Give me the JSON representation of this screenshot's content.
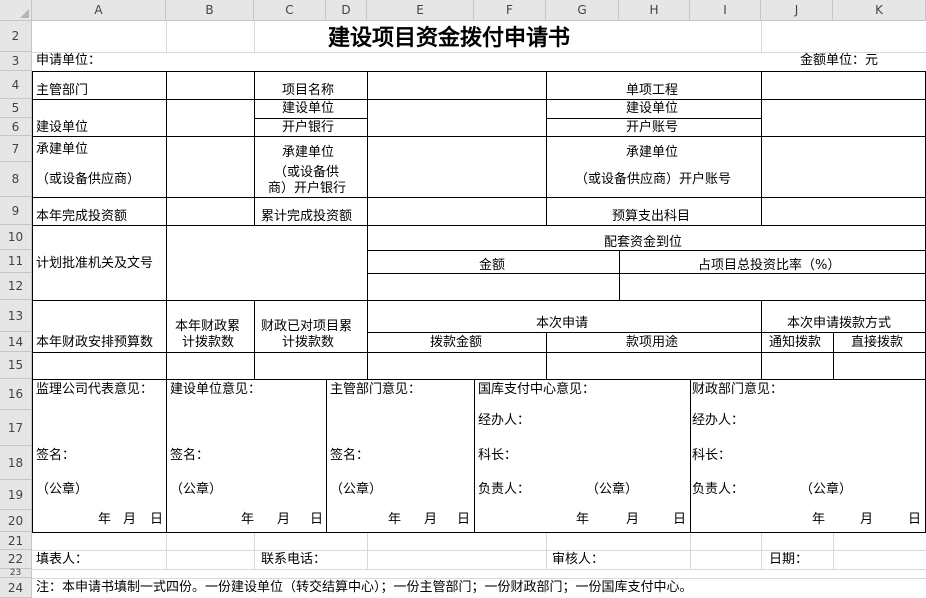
{
  "columns": [
    "A",
    "B",
    "C",
    "D",
    "E",
    "F",
    "G",
    "H",
    "I",
    "J",
    "K"
  ],
  "rows": [
    "2",
    "3",
    "4",
    "5",
    "6",
    "7",
    "8",
    "9",
    "10",
    "11",
    "12",
    "13",
    "14",
    "15",
    "16",
    "17",
    "18",
    "19",
    "20",
    "21",
    "22",
    "23",
    "24",
    "25"
  ],
  "form": {
    "title": "建设项目资金拨付申请书",
    "applicant_label": "申请单位：",
    "amount_unit": "金额单位：元",
    "dept": "主管部门",
    "project_name": "项目名称",
    "single_project": "单项工程",
    "build_unit": "建设单位",
    "bank": "开户银行",
    "account": "开户账号",
    "contractor_a": "承建单位",
    "supplier_paren": "（或设备供应商）",
    "contractor_bank_1": "（或设备供",
    "contractor_bank_2": "商）开户银行",
    "contractor_account": "（或设备供应商）开户账号",
    "year_invest": "本年完成投资额",
    "cum_invest": "累计完成投资额",
    "budget_item": "预算支出科目",
    "plan_org": "计划批准机关及文号",
    "matching": "配套资金到位",
    "amount": "金额",
    "ratio": "占项目总投资比率（%）",
    "year_budget": "本年财政安排预算数",
    "year_fiscal_1": "本年财政累",
    "year_fiscal_2": "计拨款数",
    "fiscal_cum_1": "财政已对项目累",
    "fiscal_cum_2": "计拨款数",
    "current_app": "本次申请",
    "pay_amount": "拨款金额",
    "usage": "款项用途",
    "pay_method": "本次申请拨款方式",
    "notify_pay": "通知拨款",
    "direct_pay": "直接拨款"
  },
  "opinions": {
    "supervisor": "监理公司代表意见：",
    "build": "建设单位意见：",
    "dept": "主管部门意见：",
    "treasury": "国库支付中心意见：",
    "finance": "财政部门意见：",
    "handler": "经办人：",
    "sign": "签名：",
    "section_chief": "科长：",
    "seal": "（公章）",
    "responsible": "负责人：",
    "year": "年",
    "month": "月",
    "day": "日"
  },
  "footer": {
    "filler": "填表人：",
    "phone": "联系电话：",
    "reviewer": "审核人：",
    "date": "日期：",
    "note": "注：本申请书填制一式四份。一份建设单位（转交结算中心）；一份主管部门；一份财政部门；一份国库支付中心。"
  }
}
